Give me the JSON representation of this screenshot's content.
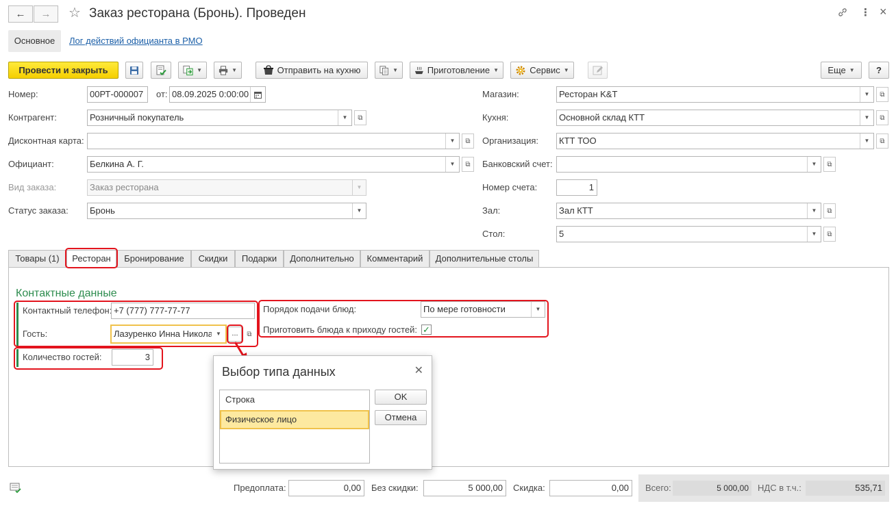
{
  "window": {
    "title": "Заказ ресторана (Бронь). Проведен",
    "back_icon": "←",
    "forward_icon": "→",
    "star_icon": "☆",
    "link_icon": "🔗",
    "more_icon": "⋮",
    "close_icon": "×"
  },
  "sections": {
    "main_label": "Основное",
    "log_link": "Лог действий официанта в РМО"
  },
  "toolbar": {
    "post_close": "Провести и закрыть",
    "send_kitchen": "Отправить на кухню",
    "preparation": "Приготовление",
    "service": "Сервис",
    "more": "Еще",
    "help": "?"
  },
  "left_fields": {
    "number_label": "Номер:",
    "number_value": "00РТ-000007",
    "date_label": "от:",
    "date_value": "08.09.2025  0:00:00",
    "counterparty_label": "Контрагент:",
    "counterparty_value": "Розничный покупатель",
    "discount_card_label": "Дисконтная карта:",
    "discount_card_value": "",
    "waiter_label": "Официант:",
    "waiter_value": "Белкина А. Г.",
    "order_type_label": "Вид заказа:",
    "order_type_value": "Заказ ресторана",
    "order_status_label": "Статус заказа:",
    "order_status_value": "Бронь"
  },
  "right_fields": {
    "shop_label": "Магазин:",
    "shop_value": "Ресторан K&T",
    "kitchen_label": "Кухня:",
    "kitchen_value": "Основной склад КТТ",
    "organization_label": "Организация:",
    "organization_value": "КТТ ТОО",
    "bank_account_label": "Банковский счет:",
    "bank_account_value": "",
    "account_number_label": "Номер счета:",
    "account_number_value": "1",
    "hall_label": "Зал:",
    "hall_value": "Зал КТТ",
    "table_label": "Стол:",
    "table_value": "5"
  },
  "tabs": [
    {
      "label": "Товары (1)"
    },
    {
      "label": "Ресторан"
    },
    {
      "label": "Бронирование"
    },
    {
      "label": "Скидки"
    },
    {
      "label": "Подарки"
    },
    {
      "label": "Дополнительно"
    },
    {
      "label": "Комментарий"
    },
    {
      "label": "Дополнительные столы"
    }
  ],
  "restaurant": {
    "contact_title": "Контактные данные",
    "phone_label": "Контактный телефон:",
    "phone_value": "+7 (777) 777-77-77",
    "guest_label": "Гость:",
    "guest_value": "Лазуренко Инна Никола",
    "guest_select_btn": "...",
    "guests_count_label": "Количество гостей:",
    "guests_count_value": "3",
    "serving_order_label": "Порядок подачи блюд:",
    "serving_order_value": "По мере готовности",
    "prepare_on_arrival_label": "Приготовить блюда к приходу гостей:",
    "prepare_on_arrival_checked": true
  },
  "dialog": {
    "title": "Выбор типа данных",
    "items": [
      "Строка",
      "Физическое лицо"
    ],
    "selected_index": 1,
    "ok_label": "OK",
    "cancel_label": "Отмена"
  },
  "footer": {
    "prepayment_label": "Предоплата:",
    "prepayment_value": "0,00",
    "no_discount_label": "Без скидки:",
    "no_discount_value": "5 000,00",
    "discount_label": "Скидка:",
    "discount_value": "0,00",
    "total_label": "Всего:",
    "total_value": "5 000,00",
    "vat_label": "НДС в т.ч.:",
    "vat_value": "535,71"
  },
  "colors": {
    "primary_button": "#f5cf00",
    "link": "#1b5fa8",
    "annotation_red": "#e3141d",
    "section_green": "#2d8c4e",
    "selected_item": "#fde9a0"
  }
}
